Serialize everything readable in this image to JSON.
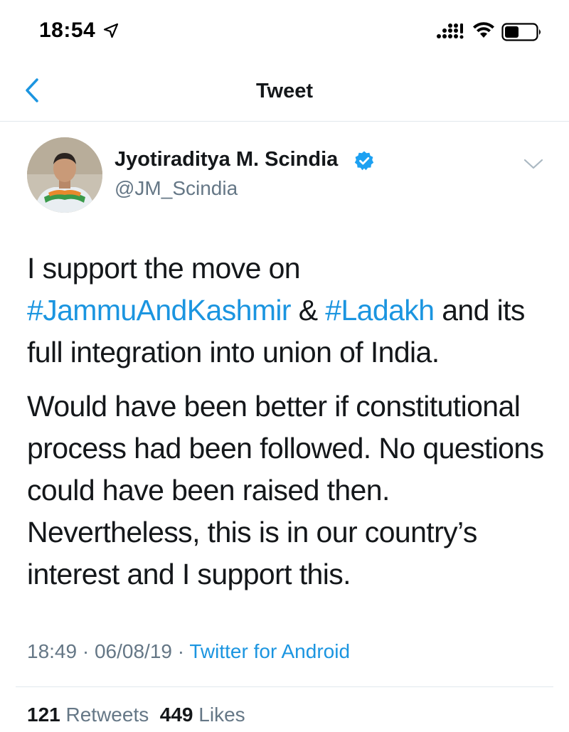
{
  "status_bar": {
    "time": "18:54",
    "icons": [
      "location-arrow-icon",
      "cellular-signal-icon",
      "wifi-icon",
      "battery-icon"
    ]
  },
  "nav": {
    "back_icon": "chevron-left-icon",
    "title": "Tweet"
  },
  "tweet": {
    "author": {
      "name": "Jyotiraditya M. Scindia",
      "handle": "@JM_Scindia",
      "verified": true,
      "verified_icon": "verified-badge-icon"
    },
    "more_icon": "chevron-down-icon",
    "body": {
      "p1_text1": "I support the move on ",
      "hashtag1": "#JammuAndKashmir",
      "p1_text2": " & ",
      "hashtag2": "#Ladakh",
      "p1_text3": " and its full integration into union of India.",
      "p2": "Would have been better if constitutional process had been followed. No questions could have been raised then. Nevertheless, this is in our country’s interest and I support this."
    },
    "meta": {
      "time": "18:49",
      "date": "06/08/19",
      "separator": " · ",
      "source": "Twitter for Android"
    },
    "stats": {
      "retweets_count": "121",
      "retweets_label": "Retweets",
      "likes_count": "449",
      "likes_label": "Likes"
    }
  },
  "colors": {
    "accent": "#1b95e0",
    "text": "#14171a",
    "secondary_text": "#657786",
    "divider": "#e1e8ed"
  }
}
